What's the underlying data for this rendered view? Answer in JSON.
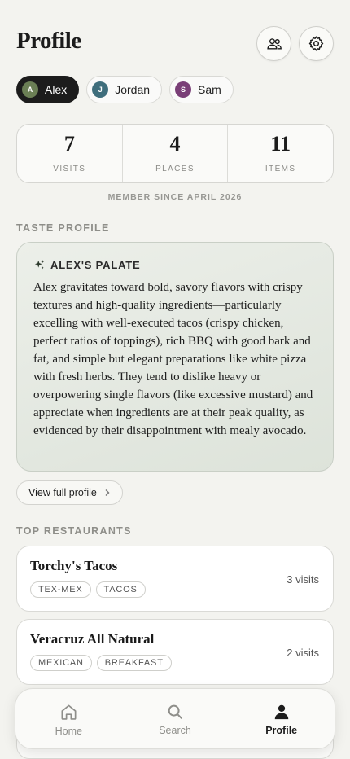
{
  "header": {
    "title": "Profile"
  },
  "users": [
    {
      "initial": "A",
      "name": "Alex",
      "color": "#6b7f55",
      "active": true
    },
    {
      "initial": "J",
      "name": "Jordan",
      "color": "#3f6e7c",
      "active": false
    },
    {
      "initial": "S",
      "name": "Sam",
      "color": "#7a3f77",
      "active": false
    }
  ],
  "stats": [
    {
      "value": "7",
      "label": "VISITS"
    },
    {
      "value": "4",
      "label": "PLACES"
    },
    {
      "value": "11",
      "label": "ITEMS"
    }
  ],
  "member_since": "MEMBER SINCE APRIL 2026",
  "taste": {
    "section_label": "TASTE PROFILE",
    "heading": "ALEX'S PALATE",
    "text": "Alex gravitates toward bold, savory flavors with crispy textures and high-quality ingredients—particularly excelling with well-executed tacos (crispy chicken, perfect ratios of toppings), rich BBQ with good bark and fat, and simple but elegant preparations like white pizza with fresh herbs. They tend to dislike heavy or overpowering single flavors (like excessive mustard) and appreciate when ingredients are at their peak quality, as evidenced by their disappointment with mealy avocado.",
    "view_button": "View full profile"
  },
  "restaurants": {
    "section_label": "TOP RESTAURANTS",
    "items": [
      {
        "name": "Torchy's Tacos",
        "tags": [
          "TEX-MEX",
          "TACOS"
        ],
        "visits": "3 visits"
      },
      {
        "name": "Veracruz All Natural",
        "tags": [
          "MEXICAN",
          "BREAKFAST"
        ],
        "visits": "2 visits"
      }
    ]
  },
  "nav": [
    {
      "label": "Home",
      "icon": "home-icon",
      "active": false
    },
    {
      "label": "Search",
      "icon": "search-icon",
      "active": false
    },
    {
      "label": "Profile",
      "icon": "person-icon",
      "active": true
    }
  ]
}
